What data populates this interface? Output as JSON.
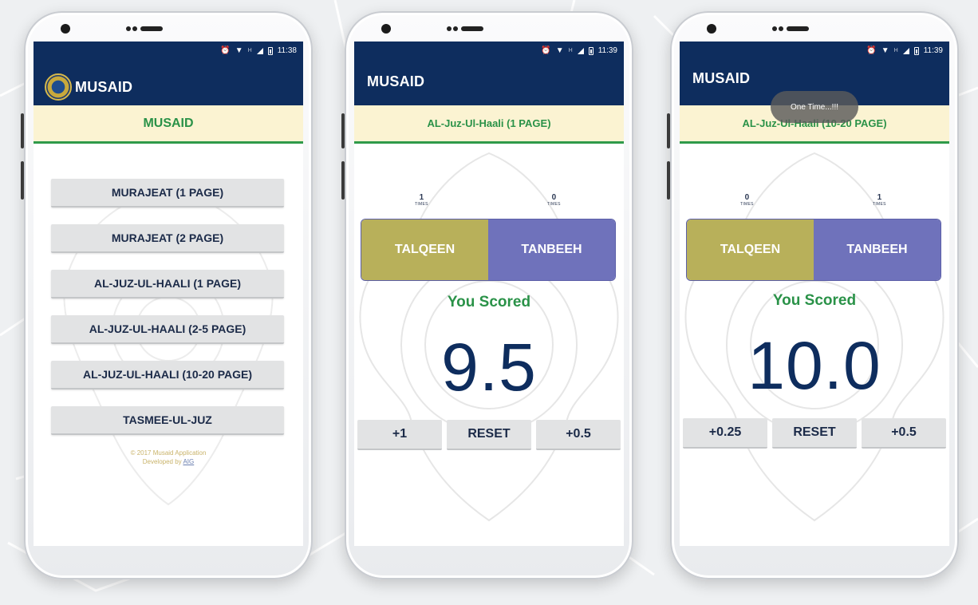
{
  "colors": {
    "appbar": "#0e2d5e",
    "accent_green": "#2a9248",
    "banner_bg": "#fbf3d2",
    "talqeen": "#b8b05a",
    "tanbeeh": "#6f72bb",
    "button_bg": "#e2e3e4"
  },
  "phones": [
    {
      "status_time": "11:38",
      "app_title": "MUSAID",
      "banner": "MUSAID",
      "menu": [
        "MURAJEAT (1 PAGE)",
        "MURAJEAT (2 PAGE)",
        "AL-JUZ-UL-HAALI (1 PAGE)",
        "AL-JUZ-UL-HAALI (2-5 PAGE)",
        "AL-JUZ-UL-HAALI (10-20 PAGE)",
        "TASMEE-UL-JUZ"
      ],
      "footer_line1": "© 2017 Musaid Application",
      "footer_line2_prefix": "Developed by ",
      "footer_link": "AIG"
    },
    {
      "status_time": "11:39",
      "app_title": "MUSAID",
      "banner": "AL-Juz-Ul-Haali (1 PAGE)",
      "counter_left": {
        "value": "1",
        "unit": "TIMES"
      },
      "counter_right": {
        "value": "0",
        "unit": "TIMES"
      },
      "toggle_left": "TALQEEN",
      "toggle_right": "TANBEEH",
      "scored_label": "You Scored",
      "score": "9.5",
      "actions": [
        "+1",
        "RESET",
        "+0.5"
      ]
    },
    {
      "status_time": "11:39",
      "app_title": "MUSAID",
      "banner": "AL-Juz-Ul-Haali (10-20 PAGE)",
      "toast": "One Time...!!!",
      "counter_left": {
        "value": "0",
        "unit": "TIMES"
      },
      "counter_right": {
        "value": "1",
        "unit": "TIMES"
      },
      "toggle_left": "TALQEEN",
      "toggle_right": "TANBEEH",
      "scored_label": "You Scored",
      "score": "10.0",
      "actions": [
        "+0.25",
        "RESET",
        "+0.5"
      ]
    }
  ]
}
